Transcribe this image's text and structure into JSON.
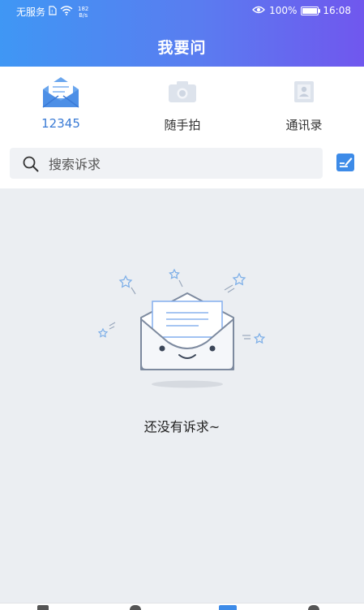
{
  "status_bar": {
    "carrier": "无服务",
    "speed_value": "182",
    "speed_unit": "B/s",
    "battery": "100%",
    "time": "16:08"
  },
  "header": {
    "title": "我要问"
  },
  "top_nav": [
    {
      "label": "12345",
      "icon": "envelope-icon",
      "active": true
    },
    {
      "label": "随手拍",
      "icon": "camera-icon",
      "active": false
    },
    {
      "label": "通讯录",
      "icon": "contacts-icon",
      "active": false
    }
  ],
  "search": {
    "placeholder": "搜索诉求",
    "value": ""
  },
  "empty_state": {
    "message": "还没有诉求~"
  },
  "colors": {
    "header_gradient_start": "#3f97f4",
    "header_gradient_end": "#7057ee",
    "active_tab": "#3a7bd5",
    "edit_button": "#3d8be8",
    "content_background": "#ebeef2"
  }
}
